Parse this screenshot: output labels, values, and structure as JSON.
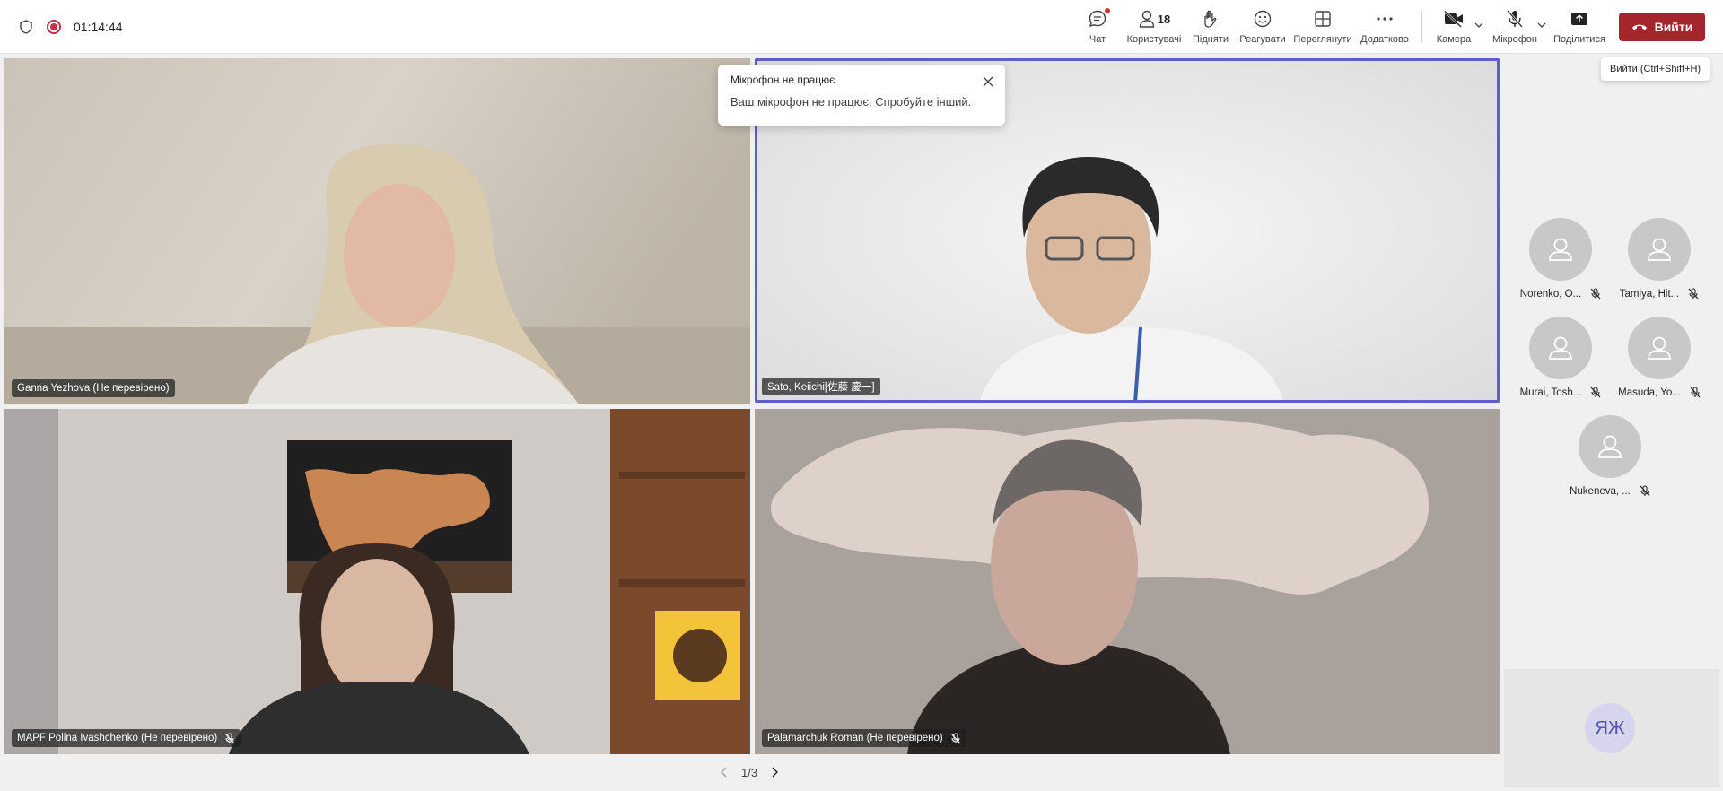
{
  "toolbar": {
    "timer": "01:14:44",
    "chat_label": "Чат",
    "people_label": "Користувачі",
    "people_count": "18",
    "raise_label": "Підняти",
    "react_label": "Реагувати",
    "view_label": "Переглянути",
    "more_label": "Додатково",
    "camera_label": "Камера",
    "mic_label": "Мікрофон",
    "share_label": "Поділитися",
    "leave_label": "Вийти",
    "leave_tooltip": "Вийти (Ctrl+Shift+H)"
  },
  "toast": {
    "title": "Мікрофон не працює",
    "body": "Ваш мікрофон не працює. Спробуйте інший."
  },
  "tiles": [
    {
      "name": "Ganna Yezhova (Не перевірено)",
      "muted": false
    },
    {
      "name": "Sato, Keiichi[佐藤 慶一]",
      "muted": false,
      "active_speaker": true
    },
    {
      "name": "MAPF Polina Ivashchenko (Не перевірено)",
      "muted": true
    },
    {
      "name": "Palamarchuk Roman (Не перевірено)",
      "muted": true
    }
  ],
  "roster": [
    {
      "name": "Norenko, O...",
      "muted": true
    },
    {
      "name": "Tamiya, Hit...",
      "muted": true
    },
    {
      "name": "Murai, Tosh...",
      "muted": true
    },
    {
      "name": "Masuda, Yo...",
      "muted": true
    },
    {
      "name": "Nukeneva, ...",
      "muted": true
    }
  ],
  "self_view": {
    "initials": "ЯЖ"
  },
  "pager": {
    "label": "1/3"
  },
  "colors": {
    "accent": "#5b5fc7",
    "leave": "#a4262c",
    "record": "#c4314b"
  }
}
